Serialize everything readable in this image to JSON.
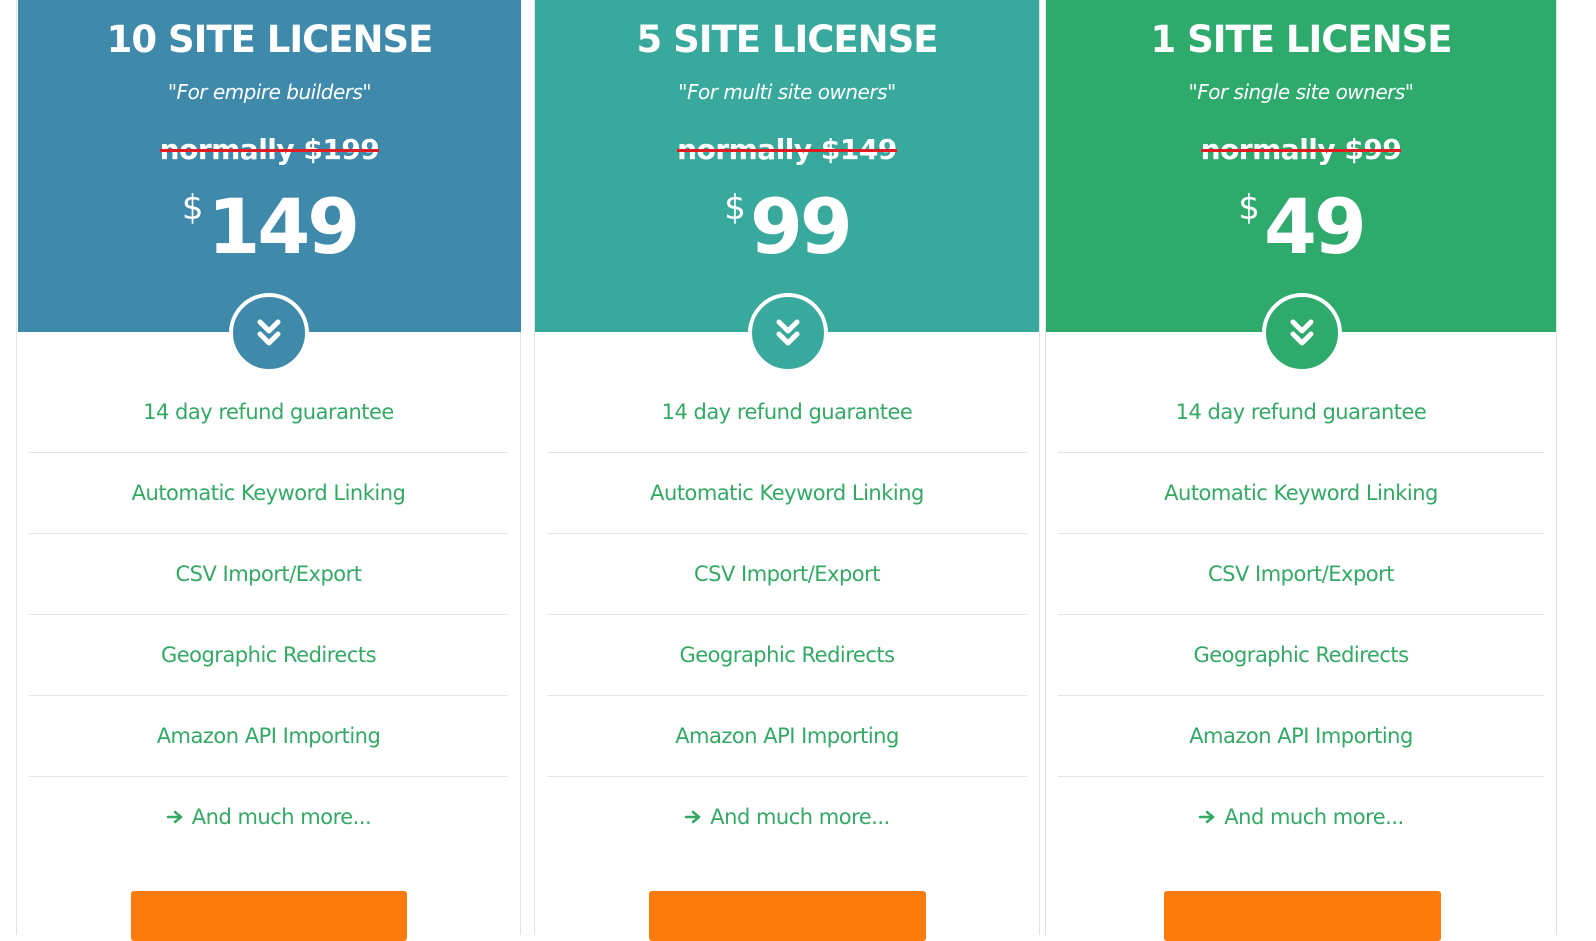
{
  "plans": [
    {
      "title": "10 SITE LICENSE",
      "tagline": "\"For empire builders\"",
      "old_price": "normally $199",
      "currency": "$",
      "price": "149",
      "header_color": "#3f8aab",
      "features": [
        "14 day refund guarantee",
        "Automatic Keyword Linking",
        "CSV Import/Export",
        "Geographic Redirects",
        "Amazon API Importing"
      ],
      "more": "And much more..."
    },
    {
      "title": "5 SITE LICENSE",
      "tagline": "\"For multi site owners\"",
      "old_price": "normally $149",
      "currency": "$",
      "price": "99",
      "header_color": "#3aa99d",
      "features": [
        "14 day refund guarantee",
        "Automatic Keyword Linking",
        "CSV Import/Export",
        "Geographic Redirects",
        "Amazon API Importing"
      ],
      "more": "And much more..."
    },
    {
      "title": "1 SITE LICENSE",
      "tagline": "\"For single site owners\"",
      "old_price": "normally $99",
      "currency": "$",
      "price": "49",
      "header_color": "#2eaa6d",
      "features": [
        "14 day refund guarantee",
        "Automatic Keyword Linking",
        "CSV Import/Export",
        "Geographic Redirects",
        "Amazon API Importing"
      ],
      "more": "And much more..."
    }
  ],
  "colors": {
    "feature_text": "#34a865",
    "strike": "#e31b23",
    "button": "#fb7c0c"
  },
  "icons": {
    "expand": "chevron-double-down-icon",
    "more": "arrow-right-icon"
  }
}
